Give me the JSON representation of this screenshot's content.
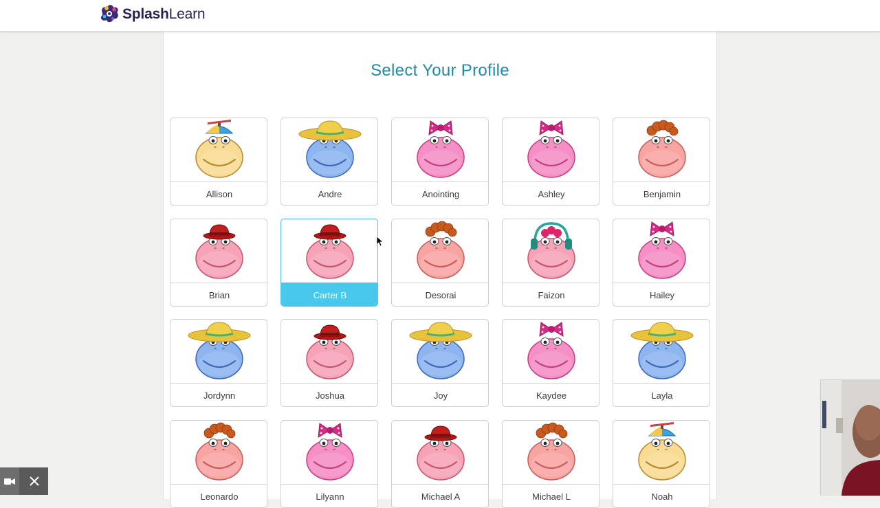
{
  "brand": {
    "name_bold": "Splash",
    "name_light": "Learn"
  },
  "page": {
    "title": "Select Your Profile"
  },
  "profiles": [
    {
      "name": "Allison",
      "avatar": "propeller-cap-yellow"
    },
    {
      "name": "Andre",
      "avatar": "sombrero-blue"
    },
    {
      "name": "Anointing",
      "avatar": "bow-pink"
    },
    {
      "name": "Ashley",
      "avatar": "bow-pink"
    },
    {
      "name": "Benjamin",
      "avatar": "curly-hair-salmon"
    },
    {
      "name": "Brian",
      "avatar": "red-hat-pink"
    },
    {
      "name": "Carter B",
      "avatar": "red-hat-pink",
      "selected": true
    },
    {
      "name": "Desorai",
      "avatar": "curly-hair-salmon"
    },
    {
      "name": "Faizon",
      "avatar": "headphones-pink"
    },
    {
      "name": "Hailey",
      "avatar": "bow-pink"
    },
    {
      "name": "Jordynn",
      "avatar": "sombrero-blue"
    },
    {
      "name": "Joshua",
      "avatar": "red-hat-pink"
    },
    {
      "name": "Joy",
      "avatar": "sombrero-blue"
    },
    {
      "name": "Kaydee",
      "avatar": "bow-pink"
    },
    {
      "name": "Layla",
      "avatar": "sombrero-blue"
    },
    {
      "name": "Leonardo",
      "avatar": "curly-hair-salmon"
    },
    {
      "name": "Lilyann",
      "avatar": "bow-pink"
    },
    {
      "name": "Michael A",
      "avatar": "red-hat-pink"
    },
    {
      "name": "Michael L",
      "avatar": "curly-hair-salmon"
    },
    {
      "name": "Noah",
      "avatar": "propeller-cap-yellow"
    }
  ],
  "colors": {
    "title": "#1f8ba5",
    "selected": "#47c8ec",
    "face_yellow": "#f9dc94",
    "face_blue": "#8db5f0",
    "face_pink": "#f6a3b8",
    "face_magenta": "#f58fc6",
    "face_salmon": "#f7a4a2"
  },
  "overlay": {
    "camera_icon": "video-camera-icon",
    "close_icon": "close-icon"
  }
}
